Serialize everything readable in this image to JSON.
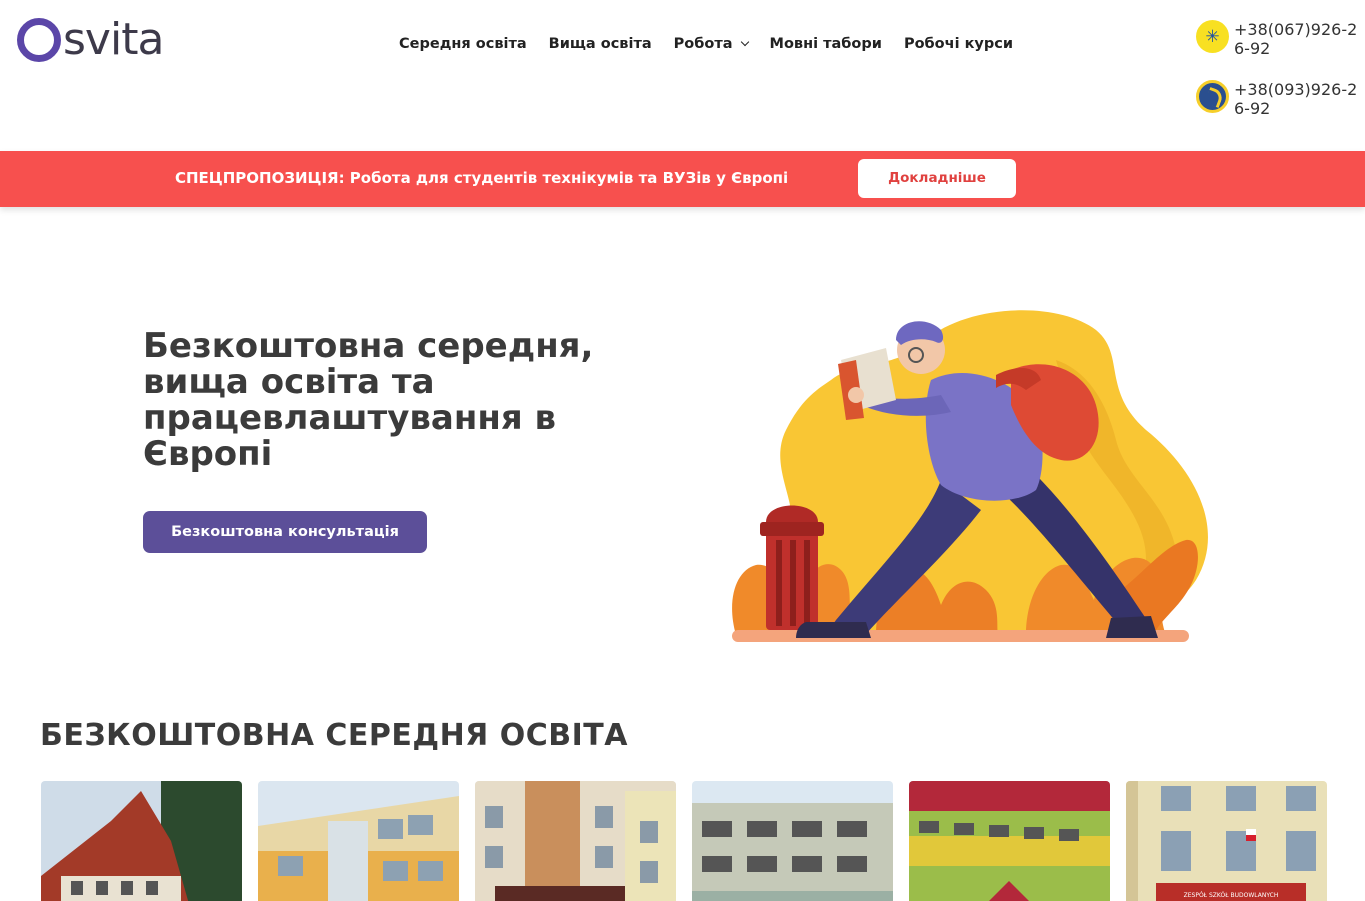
{
  "header": {
    "logo": {
      "text": "svita",
      "full": "Osvita"
    },
    "nav": [
      {
        "label": "Середня освіта"
      },
      {
        "label": "Вища освіта"
      },
      {
        "label": "Робота",
        "has_dropdown": true
      },
      {
        "label": "Мовні табори"
      },
      {
        "label": "Робочі курси"
      }
    ],
    "phones": [
      {
        "number": "+38(067)926-26-92",
        "icon": "kyivstar-icon"
      },
      {
        "number": "+38(093)926-26-92",
        "icon": "lifecell-icon"
      }
    ]
  },
  "promo": {
    "text": "СПЕЦПРОПОЗИЦІЯ: Робота для студентів технікумів та ВУЗів у Європі",
    "button_label": "Докладніше",
    "bg_color": "#f7504e"
  },
  "hero": {
    "title": "Безкоштовна середня, вища освіта та працевлаштування в Європі",
    "button_label": "Безкоштовна консультація",
    "button_color": "#5c4f99",
    "illustration": "student-reading-walking-illustration"
  },
  "section": {
    "title": "БЕЗКОШТОВНА СЕРЕДНЯ ОСВІТА",
    "cards": [
      {
        "image": "school-building-photo-1"
      },
      {
        "image": "school-building-photo-2"
      },
      {
        "image": "school-building-photo-3"
      },
      {
        "image": "school-building-photo-4"
      },
      {
        "image": "school-building-photo-5"
      },
      {
        "image": "school-building-photo-6",
        "sign": "ZESPÓŁ SZKÓŁ BUDOWLANYCH"
      }
    ]
  },
  "colors": {
    "brand": "#5b46a8",
    "accent": "#f7504e",
    "button": "#5c4f99"
  }
}
